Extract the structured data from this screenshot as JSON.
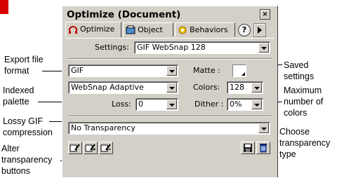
{
  "panel": {
    "title": "Optimize (Document)",
    "close_glyph": "×",
    "tabs": [
      {
        "label": "Optimize",
        "icon": "optimize-icon"
      },
      {
        "label": "Object",
        "icon": "object-icon"
      },
      {
        "label": "Behaviors",
        "icon": "behaviors-icon"
      }
    ],
    "help_glyph": "?",
    "settings_label": "Settings:",
    "settings_value": "GIF WebSnap 128",
    "format_value": "GIF",
    "matte_label": "Matte :",
    "palette_value": "WebSnap Adaptive",
    "colors_label": "Colors:",
    "colors_value": "128",
    "loss_label": "Loss:",
    "loss_value": "0",
    "dither_label": "Dither :",
    "dither_value": "0%",
    "transparency_value": "No Transparency"
  },
  "annotations": {
    "export_format_1": "Export file",
    "export_format_2": "format",
    "indexed_1": "Indexed",
    "indexed_2": "palette",
    "lossy_1": "Lossy GIF",
    "lossy_2": "compression",
    "alter_1": "Alter",
    "alter_2": "transparency",
    "alter_3": "buttons",
    "saved_1": "Saved",
    "saved_2": "settings",
    "max_1": "Maximum",
    "max_2": "number of",
    "max_3": "colors",
    "choose_1": "Choose",
    "choose_2": "transparency",
    "choose_3": "type"
  },
  "colors": {
    "panel_bg": "#d4d0c8",
    "accent_red": "#d90000"
  }
}
